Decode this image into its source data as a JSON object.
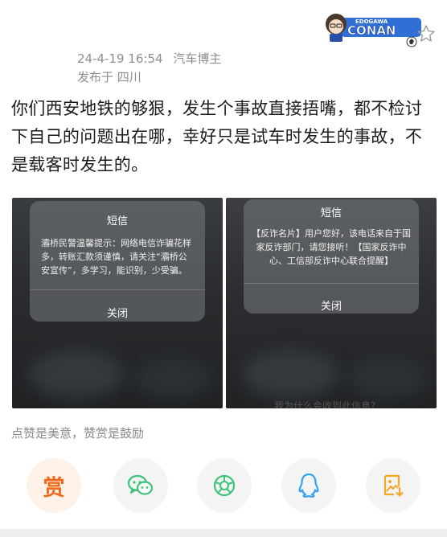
{
  "post": {
    "date": "24-4-19 16:54",
    "author": "汽车博主",
    "location": "发布于 四川",
    "content": "你们西安地铁的够狠，发生个事故直接捂嘴，都不检讨下自己的问题出在哪，幸好只是试车时发生的事故，不是载客时发生的。"
  },
  "logo": {
    "text": "EDOGAWA CONAN"
  },
  "images": [
    {
      "dialog_title": "短信",
      "dialog_body": "灞桥民警温馨提示：网络电信诈骗花样多，转账汇款须谨慎，请关注“灞桥公安宣传”，多学习，能识别，少受骗。",
      "dialog_button": "关闭"
    },
    {
      "dialog_title": "短信",
      "dialog_body": "【反诈名片】用户您好，该电话来自于国家反诈部门，请您接听！【国家反诈中心、工信部反诈中心联合提醒】",
      "dialog_button": "关闭",
      "faint_text": "我为什么会收到此信息?"
    }
  ],
  "reward": {
    "hint": "点赞是美意，赞赏是鼓励",
    "char": "赏"
  },
  "share_buttons": [
    "wechat-icon",
    "moments-icon",
    "qq-icon",
    "save-image-icon"
  ],
  "colors": {
    "reward_orange": "#f06a1c",
    "share_green": "#3dc37a",
    "qq_blue": "#3aa0f0",
    "save_orange": "#f5a623"
  }
}
